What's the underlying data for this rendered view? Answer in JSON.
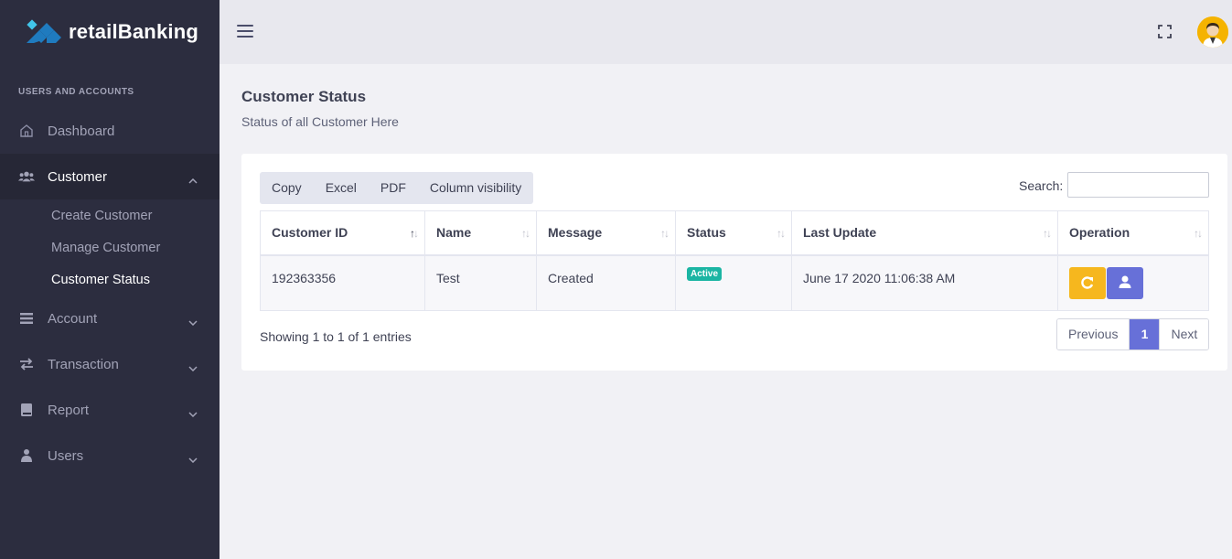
{
  "brand": {
    "name": "retailBanking",
    "colors": {
      "accent": "#41c4e8",
      "dark": "#1f7bbf"
    }
  },
  "sidebar": {
    "section_label": "USERS AND ACCOUNTS",
    "items": [
      {
        "label": "Dashboard",
        "icon": "home-icon"
      },
      {
        "label": "Customer",
        "icon": "users-icon",
        "expanded": true,
        "children": [
          {
            "label": "Create Customer"
          },
          {
            "label": "Manage Customer"
          },
          {
            "label": "Customer Status",
            "active": true
          }
        ]
      },
      {
        "label": "Account",
        "icon": "list-icon"
      },
      {
        "label": "Transaction",
        "icon": "transfer-icon"
      },
      {
        "label": "Report",
        "icon": "book-icon"
      },
      {
        "label": "Users",
        "icon": "user-group-icon"
      }
    ]
  },
  "header": {
    "menu_icon": "hamburger-icon",
    "fullscreen_icon": "fullscreen-icon",
    "avatar_icon": "user-avatar-icon"
  },
  "page": {
    "title": "Customer Status",
    "subtitle": "Status of all Customer Here"
  },
  "toolbar": {
    "buttons": [
      "Copy",
      "Excel",
      "PDF",
      "Column visibility"
    ],
    "search_label": "Search:",
    "search_value": ""
  },
  "table": {
    "columns": [
      "Customer ID",
      "Name",
      "Message",
      "Status",
      "Last Update",
      "Operation"
    ],
    "rows": [
      {
        "customer_id": "192363356",
        "name": "Test",
        "message": "Created",
        "status": "Active",
        "last_update": "June 17 2020 11:06:38 AM"
      }
    ]
  },
  "footer": {
    "info": "Showing 1 to 1 of 1 entries",
    "previous": "Previous",
    "current_page": "1",
    "next": "Next"
  },
  "colors": {
    "sidebar_bg": "#2c2d3f",
    "status_active": "#1bb5a3",
    "reset_button": "#f6b71e",
    "primary": "#6770d8"
  }
}
